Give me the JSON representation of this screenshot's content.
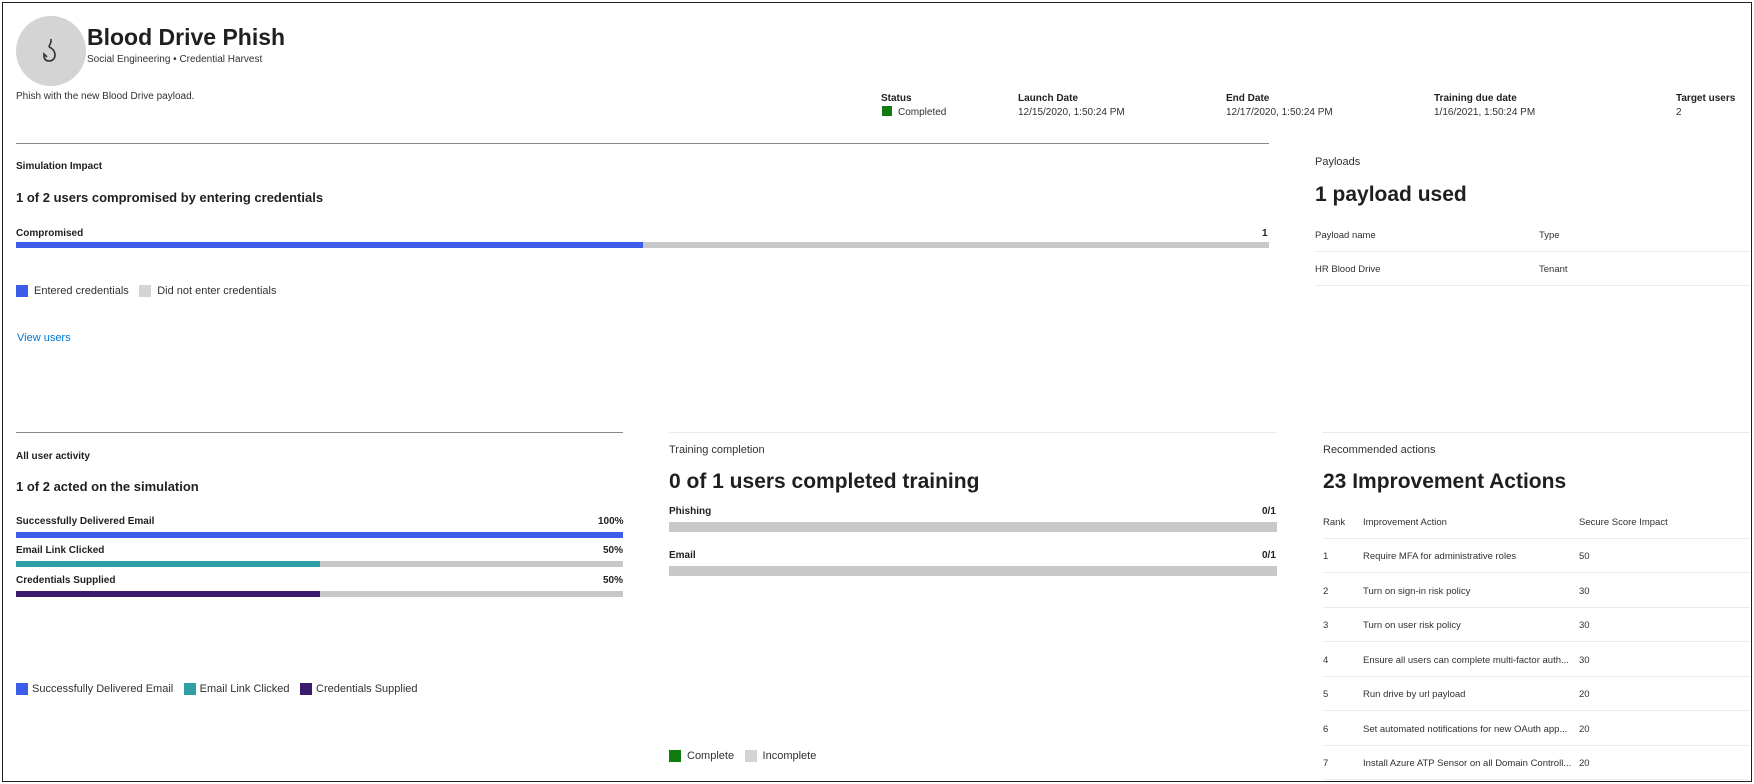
{
  "header": {
    "title": "Blood Drive Phish",
    "subtitle": "Social Engineering • Credential Harvest",
    "description": "Phish with the new Blood Drive payload.",
    "meta": [
      {
        "label": "Status",
        "value": "Completed"
      },
      {
        "label": "Launch Date",
        "value": "12/15/2020, 1:50:24 PM"
      },
      {
        "label": "End Date",
        "value": "12/17/2020, 1:50:24 PM"
      },
      {
        "label": "Training due date",
        "value": "1/16/2021, 1:50:24 PM"
      },
      {
        "label": "Target users",
        "value": "2"
      }
    ]
  },
  "impact": {
    "section": "Simulation Impact",
    "headline": "1 of 2 users compromised by entering credentials",
    "bar_label": "Compromised",
    "bar_value": "1",
    "bar_fraction": 0.5,
    "legend": [
      "Entered credentials",
      "Did not enter credentials"
    ],
    "link": "View users"
  },
  "payloads": {
    "section": "Payloads",
    "headline": "1 payload used",
    "columns": [
      "Payload name",
      "Type"
    ],
    "rows": [
      [
        "HR Blood Drive",
        "Tenant"
      ]
    ]
  },
  "activity": {
    "section": "All user activity",
    "headline": "1 of 2 acted on the simulation",
    "bars": [
      {
        "label": "Successfully Delivered Email",
        "value": "100%",
        "fraction": 1.0
      },
      {
        "label": "Email Link Clicked",
        "value": "50%",
        "fraction": 0.5
      },
      {
        "label": "Credentials Supplied",
        "value": "50%",
        "fraction": 0.5
      }
    ],
    "legend": [
      "Successfully Delivered Email",
      "Email Link Clicked",
      "Credentials Supplied"
    ]
  },
  "training": {
    "section": "Training completion",
    "headline": "0 of 1 users completed training",
    "bars": [
      {
        "label": "Phishing",
        "value": "0/1",
        "fraction": 0
      },
      {
        "label": "Email",
        "value": "0/1",
        "fraction": 0
      }
    ],
    "legend": [
      "Complete",
      "Incomplete"
    ]
  },
  "actions": {
    "section": "Recommended actions",
    "headline": "23 Improvement Actions",
    "columns": [
      "Rank",
      "Improvement Action",
      "Secure Score Impact"
    ],
    "rows": [
      [
        "1",
        "Require MFA for administrative roles",
        "50"
      ],
      [
        "2",
        "Turn on sign-in risk policy",
        "30"
      ],
      [
        "3",
        "Turn on user risk policy",
        "30"
      ],
      [
        "4",
        "Ensure all users can complete multi-factor auth...",
        "30"
      ],
      [
        "5",
        "Run drive by url payload",
        "20"
      ],
      [
        "6",
        "Set automated notifications for new OAuth app...",
        "20"
      ],
      [
        "7",
        "Install Azure ATP Sensor on all Domain Controll...",
        "20"
      ]
    ]
  },
  "colors": {
    "blue": "#3b5de7",
    "teal": "#2f9fa6",
    "purple": "#3c1a6e",
    "green": "#107c10",
    "gray": "#c8c8c8",
    "link": "#0078d4"
  }
}
